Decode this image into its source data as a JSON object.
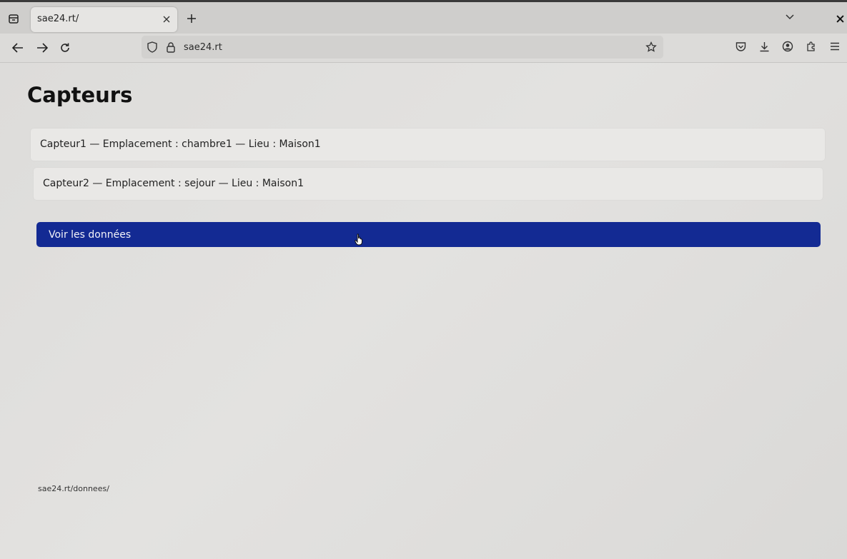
{
  "browser": {
    "tab_title": "sae24.rt/",
    "url": "sae24.rt",
    "status_url": "sae24.rt/donnees/",
    "icons": {
      "tab_overview": "folder-tabs-icon",
      "tab_close": "close-icon",
      "new_tab": "plus-icon",
      "tab_list": "chevron-down-icon",
      "window_close": "close-icon",
      "back": "arrow-left-icon",
      "forward": "arrow-right-icon",
      "reload": "reload-icon",
      "tracking_protection": "shield-icon",
      "site_lock": "lock-icon",
      "bookmark": "star-icon",
      "pocket": "pocket-icon",
      "downloads": "download-icon",
      "account": "account-icon",
      "extensions": "puzzle-icon",
      "menu": "hamburger-menu-icon"
    }
  },
  "page": {
    "title": "Capteurs",
    "sensors": [
      {
        "label": "Capteur1 — Emplacement : chambre1 — Lieu : Maison1"
      },
      {
        "label": "Capteur2 — Emplacement : sejour — Lieu : Maison1"
      }
    ],
    "view_data_button": "Voir les données"
  },
  "colors": {
    "button_background": "#132a93",
    "button_text": "#f3f3f8",
    "page_background": "#e0dfdd"
  }
}
